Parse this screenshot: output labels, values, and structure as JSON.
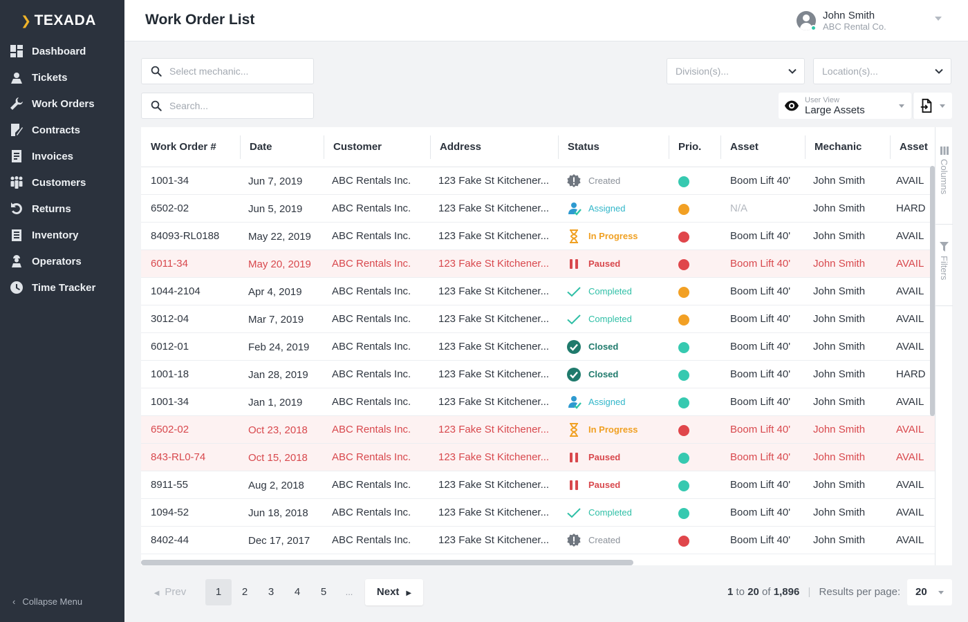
{
  "brand": {
    "name": "TEXADA"
  },
  "sidebar": {
    "items": [
      {
        "label": "Dashboard",
        "icon": "dashboard-icon"
      },
      {
        "label": "Tickets",
        "icon": "ticket-icon"
      },
      {
        "label": "Work Orders",
        "icon": "wrench-icon"
      },
      {
        "label": "Contracts",
        "icon": "contract-icon"
      },
      {
        "label": "Invoices",
        "icon": "invoice-icon"
      },
      {
        "label": "Customers",
        "icon": "customers-icon"
      },
      {
        "label": "Returns",
        "icon": "returns-icon"
      },
      {
        "label": "Inventory",
        "icon": "inventory-icon"
      },
      {
        "label": "Operators",
        "icon": "operator-icon"
      },
      {
        "label": "Time Tracker",
        "icon": "clock-icon"
      }
    ],
    "collapse_label": "Collapse Menu"
  },
  "header": {
    "title": "Work Order List",
    "user_name": "John Smith",
    "user_company": "ABC Rental Co."
  },
  "filters": {
    "mechanic_placeholder": "Select mechanic...",
    "search_placeholder": "Search...",
    "division_placeholder": "Division(s)...",
    "location_placeholder": "Location(s)...",
    "user_view_label": "User View",
    "user_view_value": "Large Assets"
  },
  "table": {
    "columns": [
      "Work Order #",
      "Date",
      "Customer",
      "Address",
      "Status",
      "Prio.",
      "Asset",
      "Mechanic",
      "Asset"
    ],
    "side_panel": {
      "columns_label": "Columns",
      "filters_label": "Filters"
    },
    "rows": [
      {
        "wo": "1001-34",
        "date": "Jun 7, 2019",
        "customer": "ABC Rentals Inc.",
        "address": "123 Fake St Kitchener...",
        "status": "Created",
        "prio": "teal",
        "asset": "Boom Lift 40'",
        "mechanic": "John Smith",
        "asset_status": "AVAIL",
        "alert": false
      },
      {
        "wo": "6502-02",
        "date": "Jun 5, 2019",
        "customer": "ABC Rentals Inc.",
        "address": "123 Fake St Kitchener...",
        "status": "Assigned",
        "prio": "orange",
        "asset": "N/A",
        "mechanic": "John Smith",
        "asset_status": "HARD",
        "alert": false
      },
      {
        "wo": "84093-RL0188",
        "date": "May 22, 2019",
        "customer": "ABC Rentals Inc.",
        "address": "123 Fake St Kitchener...",
        "status": "In Progress",
        "prio": "red",
        "asset": "Boom Lift 40'",
        "mechanic": "John Smith",
        "asset_status": "AVAIL",
        "alert": false
      },
      {
        "wo": "6011-34",
        "date": "May 20, 2019",
        "customer": "ABC Rentals Inc.",
        "address": "123 Fake St Kitchener...",
        "status": "Paused",
        "prio": "red",
        "asset": "Boom Lift 40'",
        "mechanic": "John Smith",
        "asset_status": "AVAIL",
        "alert": true
      },
      {
        "wo": "1044-2104",
        "date": "Apr 4, 2019",
        "customer": "ABC Rentals Inc.",
        "address": "123 Fake St Kitchener...",
        "status": "Completed",
        "prio": "orange",
        "asset": "Boom Lift 40'",
        "mechanic": "John Smith",
        "asset_status": "AVAIL",
        "alert": false
      },
      {
        "wo": "3012-04",
        "date": "Mar 7, 2019",
        "customer": "ABC Rentals Inc.",
        "address": "123 Fake St Kitchener...",
        "status": "Completed",
        "prio": "orange",
        "asset": "Boom Lift 40'",
        "mechanic": "John Smith",
        "asset_status": "AVAIL",
        "alert": false
      },
      {
        "wo": "6012-01",
        "date": "Feb 24, 2019",
        "customer": "ABC Rentals Inc.",
        "address": "123 Fake St Kitchener...",
        "status": "Closed",
        "prio": "teal",
        "asset": "Boom Lift 40'",
        "mechanic": "John Smith",
        "asset_status": "AVAIL",
        "alert": false
      },
      {
        "wo": "1001-18",
        "date": "Jan 28, 2019",
        "customer": "ABC Rentals Inc.",
        "address": "123 Fake St Kitchener...",
        "status": "Closed",
        "prio": "teal",
        "asset": "Boom Lift 40'",
        "mechanic": "John Smith",
        "asset_status": "HARD",
        "alert": false
      },
      {
        "wo": "1001-34",
        "date": "Jan 1, 2019",
        "customer": "ABC Rentals Inc.",
        "address": "123 Fake St Kitchener...",
        "status": "Assigned",
        "prio": "teal",
        "asset": "Boom Lift 40'",
        "mechanic": "John Smith",
        "asset_status": "AVAIL",
        "alert": false
      },
      {
        "wo": "6502-02",
        "date": "Oct 23, 2018",
        "customer": "ABC Rentals Inc.",
        "address": "123 Fake St Kitchener...",
        "status": "In Progress",
        "prio": "red",
        "asset": "Boom Lift 40'",
        "mechanic": "John Smith",
        "asset_status": "AVAIL",
        "alert": true
      },
      {
        "wo": "843-RL0-74",
        "date": "Oct 15, 2018",
        "customer": "ABC Rentals Inc.",
        "address": "123 Fake St Kitchener...",
        "status": "Paused",
        "prio": "teal",
        "asset": "Boom Lift 40'",
        "mechanic": "John Smith",
        "asset_status": "AVAIL",
        "alert": true
      },
      {
        "wo": "8911-55",
        "date": "Aug 2, 2018",
        "customer": "ABC Rentals Inc.",
        "address": "123 Fake St Kitchener...",
        "status": "Paused",
        "prio": "teal",
        "asset": "Boom Lift 40'",
        "mechanic": "John Smith",
        "asset_status": "AVAIL",
        "alert": false
      },
      {
        "wo": "1094-52",
        "date": "Jun 18, 2018",
        "customer": "ABC Rentals Inc.",
        "address": "123 Fake St Kitchener...",
        "status": "Completed",
        "prio": "teal",
        "asset": "Boom Lift 40'",
        "mechanic": "John Smith",
        "asset_status": "AVAIL",
        "alert": false
      },
      {
        "wo": "8402-44",
        "date": "Dec 17, 2017",
        "customer": "ABC Rentals Inc.",
        "address": "123 Fake St Kitchener...",
        "status": "Created",
        "prio": "red",
        "asset": "Boom Lift 40'",
        "mechanic": "John Smith",
        "asset_status": "AVAIL",
        "alert": false
      }
    ]
  },
  "pagination": {
    "prev_label": "Prev",
    "pages": [
      "1",
      "2",
      "3",
      "4",
      "5"
    ],
    "ellipsis": "...",
    "next_label": "Next",
    "range_start": "1",
    "range_end": "20",
    "total": "1,896",
    "results_per_page_label": "Results per page:",
    "results_per_page": "20"
  },
  "colors": {
    "sidebar_bg": "#2b323d",
    "prio_teal": "#36c9b0",
    "prio_orange": "#f2a024",
    "prio_red": "#e0464b",
    "alert_text": "#d8484d"
  }
}
